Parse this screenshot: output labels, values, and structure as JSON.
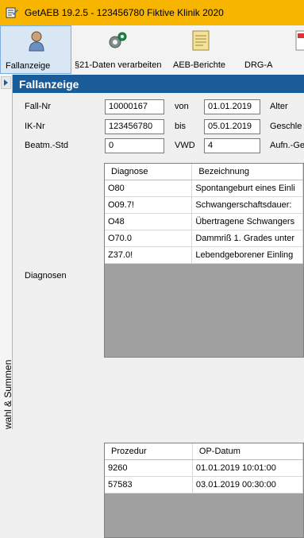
{
  "window": {
    "title": "GetAEB 19.2.5 - 123456780 Fiktive Klinik 2020"
  },
  "toolbar": {
    "buttons": [
      {
        "label": "Fallanzeige",
        "icon": "user-icon",
        "active": true
      },
      {
        "label": "§21-Daten verarbeiten",
        "icon": "gears-icon",
        "active": false
      },
      {
        "label": "AEB-Berichte",
        "icon": "report-icon",
        "active": false
      },
      {
        "label": "DRG-A",
        "icon": "drg-icon",
        "active": false
      }
    ]
  },
  "leftstrip": {
    "label": "wahl & Summen"
  },
  "panel": {
    "title": "Fallanzeige",
    "fields": {
      "fall_nr": {
        "label": "Fall-Nr",
        "value": "10000167"
      },
      "von": {
        "label": "von",
        "value": "01.01.2019"
      },
      "alter": {
        "label": "Alter"
      },
      "ik_nr": {
        "label": "IK-Nr",
        "value": "123456780"
      },
      "bis": {
        "label": "bis",
        "value": "05.01.2019"
      },
      "geschlecht": {
        "label": "Geschle"
      },
      "beatm_std": {
        "label": "Beatm.-Std",
        "value": "0"
      },
      "vwd": {
        "label": "VWD",
        "value": "4"
      },
      "aufn": {
        "label": "Aufn.-Ge"
      }
    },
    "diagnosen": {
      "label": "Diagnosen",
      "columns": [
        "Diagnose",
        "Bezeichnung"
      ],
      "rows": [
        [
          "O80",
          "Spontangeburt eines Einli"
        ],
        [
          "O09.7!",
          "Schwangerschaftsdauer:"
        ],
        [
          "O48",
          "Übertragene Schwangers"
        ],
        [
          "O70.0",
          "Dammriß 1. Grades unter"
        ],
        [
          "Z37.0!",
          "Lebendgeborener Einling"
        ]
      ]
    },
    "prozeduren": {
      "columns": [
        "Prozedur",
        "OP-Datum"
      ],
      "rows": [
        [
          "9260",
          "01.01.2019 10:01:00"
        ],
        [
          "57583",
          "03.01.2019 00:30:00"
        ]
      ]
    }
  }
}
